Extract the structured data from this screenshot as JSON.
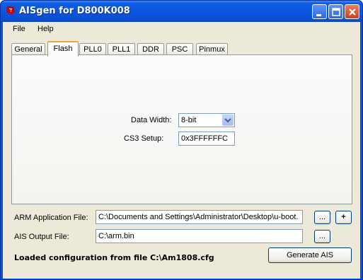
{
  "window": {
    "title": "AISgen for D800K008",
    "icon": "ti-logo-icon",
    "controls": [
      "minimize",
      "maximize",
      "close"
    ]
  },
  "menu": {
    "items": [
      "File",
      "Help"
    ]
  },
  "tabs": {
    "items": [
      "General",
      "Flash",
      "PLL0",
      "PLL1",
      "DDR",
      "PSC",
      "Pinmux"
    ],
    "active": "Flash"
  },
  "flash": {
    "data_width_label": "Data Width:",
    "data_width_value": "8-bit",
    "cs3_label": "CS3 Setup:",
    "cs3_value": "0x3FFFFFFC"
  },
  "files": {
    "arm_label": "ARM Application File:",
    "arm_value": "C:\\Documents and Settings\\Administrator\\Desktop\\u-boot.",
    "ais_label": "AIS Output File:",
    "ais_value": "C:\\arm.bin",
    "browse_label": "...",
    "add_label": "+"
  },
  "footer": {
    "status": "Loaded configuration from file C:\\Am1808.cfg",
    "generate_label": "Generate AIS"
  },
  "colors": {
    "titlebar": "#0a55dc",
    "client": "#ece9d8",
    "active_tab_accent": "#f2a53b",
    "logo": "#cc0000"
  }
}
